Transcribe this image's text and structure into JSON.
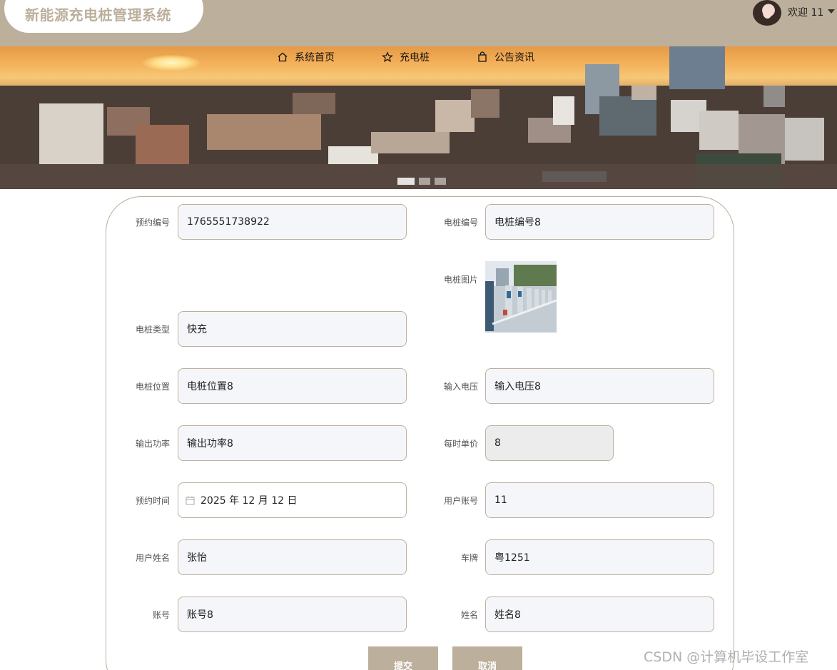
{
  "app": {
    "title": "新能源充电桩管理系统"
  },
  "user": {
    "welcome": "欢迎 11"
  },
  "nav": [
    {
      "label": "系统首页",
      "icon": "home-icon"
    },
    {
      "label": "充电桩",
      "icon": "star-icon"
    },
    {
      "label": "公告资讯",
      "icon": "bag-icon"
    }
  ],
  "carousel": {
    "slides": 3,
    "active": 1
  },
  "form": {
    "booking_no": {
      "label": "预约编号",
      "value": "1765551738922"
    },
    "pile_no": {
      "label": "电桩编号",
      "value": "电桩编号8"
    },
    "pile_image": {
      "label": "电桩图片"
    },
    "pile_type": {
      "label": "电桩类型",
      "value": "快充"
    },
    "pile_location": {
      "label": "电桩位置",
      "value": "电桩位置8"
    },
    "input_voltage": {
      "label": "输入电压",
      "value": "输入电压8"
    },
    "output_power": {
      "label": "输出功率",
      "value": "输出功率8"
    },
    "hourly_price": {
      "label": "每时单价",
      "value": "8"
    },
    "booking_time": {
      "label": "预约时间",
      "value": "2025 年 12 月 12 日"
    },
    "user_account": {
      "label": "用户账号",
      "value": "11"
    },
    "user_name": {
      "label": "用户姓名",
      "value": "张怡"
    },
    "plate": {
      "label": "车牌",
      "value": "粤1251"
    },
    "account": {
      "label": "账号",
      "value": "账号8"
    },
    "name": {
      "label": "姓名",
      "value": "姓名8"
    }
  },
  "buttons": {
    "submit": "提交",
    "cancel": "取消"
  },
  "watermark": "CSDN @计算机毕设工作室",
  "colors": {
    "accent": "#bcaf9b",
    "field_bg": "#f5f6fa"
  }
}
